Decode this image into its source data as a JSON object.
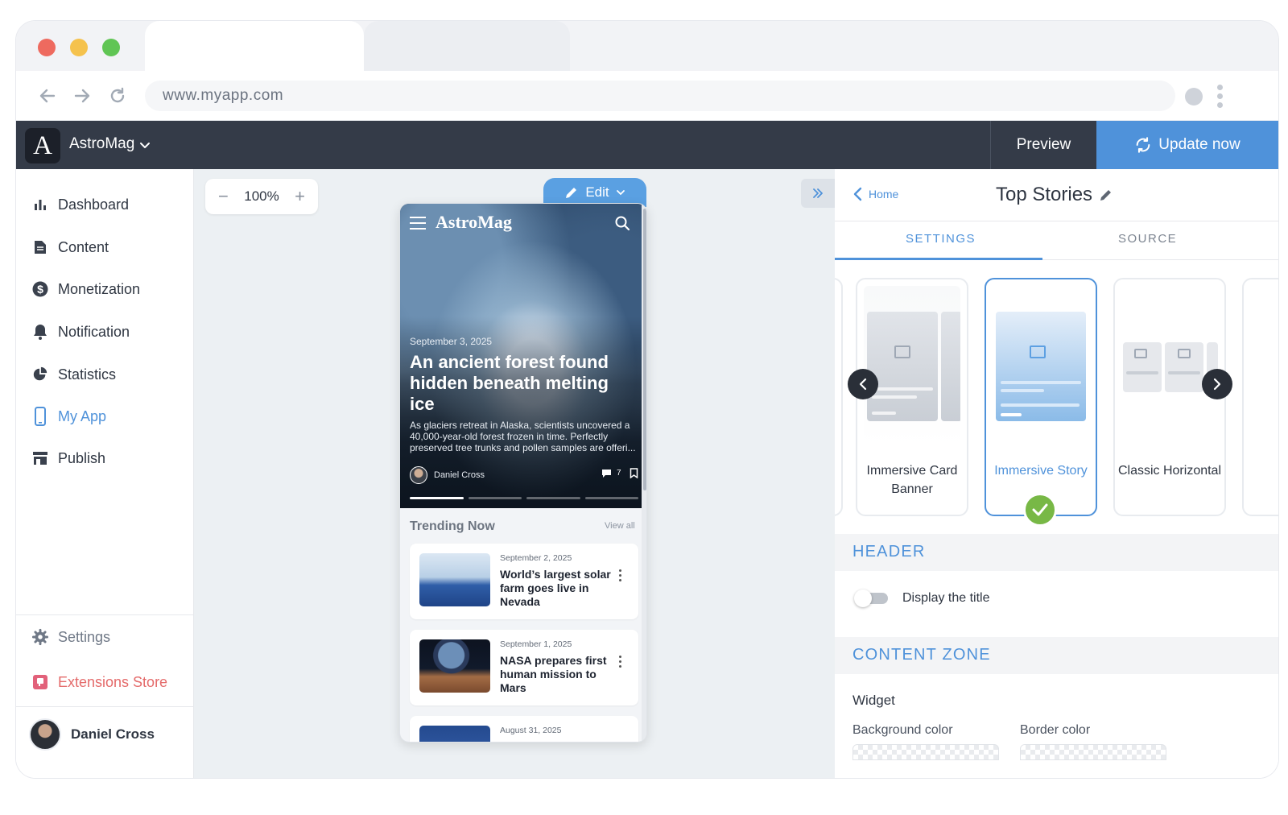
{
  "browser": {
    "url": "www.myapp.com"
  },
  "header": {
    "app_name": "AstroMag",
    "logo_letter": "A",
    "preview_label": "Preview",
    "update_label": "Update now"
  },
  "sidebar": {
    "items": [
      {
        "label": "Dashboard",
        "icon": "bar-chart-icon"
      },
      {
        "label": "Content",
        "icon": "document-icon"
      },
      {
        "label": "Monetization",
        "icon": "dollar-icon"
      },
      {
        "label": "Notification",
        "icon": "bell-icon"
      },
      {
        "label": "Statistics",
        "icon": "pie-chart-icon"
      },
      {
        "label": "My App",
        "icon": "phone-icon",
        "active": true
      },
      {
        "label": "Publish",
        "icon": "store-icon"
      }
    ],
    "settings_label": "Settings",
    "extensions_label": "Extensions Store",
    "user_name": "Daniel Cross"
  },
  "canvas": {
    "zoom_level": "100%",
    "edit_label": "Edit"
  },
  "phone": {
    "brand": "AstroMag",
    "hero": {
      "date": "September 3, 2025",
      "title": "An ancient forest found hidden beneath melting ice",
      "description": "As glaciers retreat in Alaska, scientists uncovered a 40,000-year-old forest frozen in time. Perfectly preserved tree trunks and pollen samples are offeri...",
      "author": "Daniel Cross",
      "comments": "7"
    },
    "trending_title": "Trending Now",
    "view_all": "View all",
    "articles": [
      {
        "date": "September 2, 2025",
        "title": "World’s largest solar farm goes live in Nevada"
      },
      {
        "date": "September 1, 2025",
        "title": "NASA prepares first human mission to Mars"
      },
      {
        "date": "August 31, 2025",
        "title": ""
      }
    ]
  },
  "panel": {
    "back_label": "Home",
    "title": "Top Stories",
    "tabs": [
      "SETTINGS",
      "SOURCE"
    ],
    "templates": [
      {
        "label": "Immersive Card Banner"
      },
      {
        "label": "Immersive Story",
        "selected": true
      },
      {
        "label": "Classic Horizontal"
      }
    ],
    "header_section": "HEADER",
    "display_title_label": "Display the title",
    "display_title_on": false,
    "content_zone_section": "CONTENT ZONE",
    "widget_label": "Widget",
    "background_color_label": "Background color",
    "border_color_label": "Border color"
  },
  "colors": {
    "accent": "#4f92da",
    "header_bg": "#343b48",
    "extensions": "#e46a6a",
    "check": "#78b846"
  }
}
